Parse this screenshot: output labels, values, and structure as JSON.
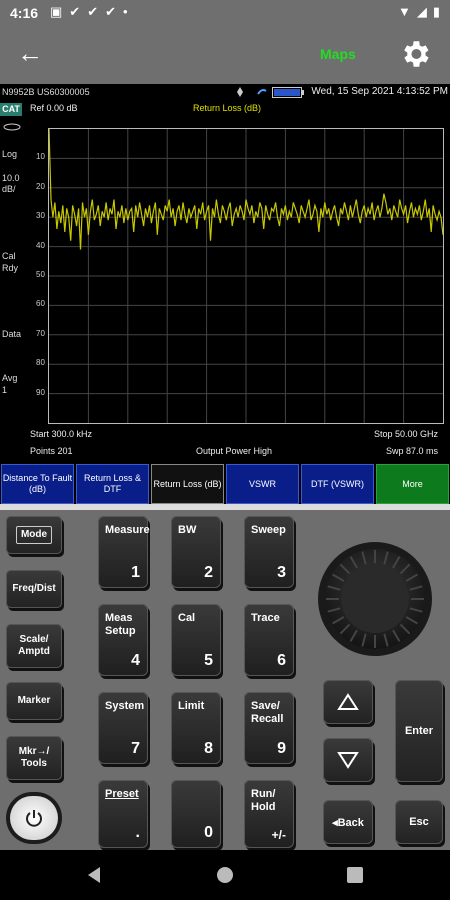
{
  "status_bar": {
    "time": "4:16"
  },
  "app_bar": {
    "maps_label": "Maps"
  },
  "instrument": {
    "model_serial": "N9952B US60300005",
    "datetime": "Wed, 15 Sep 2021 4:13:52 PM",
    "cat_label": "CAT",
    "side_labels": {
      "log": "Log",
      "scale": "10.0",
      "scale_unit": "dB/",
      "cal": "Cal",
      "cal_state": "Rdy",
      "data": "Data",
      "avg": "Avg",
      "avg_val": "1"
    },
    "ref_level": "Ref 0.00 dB",
    "trace_title": "Return Loss (dB)",
    "start": "Start 300.0 kHz",
    "stop": "Stop 50.00 GHz",
    "points": "Points 201",
    "output_power": "Output Power High",
    "sweep": "Swp 87.0 ms",
    "softkeys": [
      {
        "label": "Distance To Fault (dB)"
      },
      {
        "label": "Return Loss & DTF"
      },
      {
        "label": "Return Loss (dB)"
      },
      {
        "label": "VSWR"
      },
      {
        "label": "DTF (VSWR)"
      },
      {
        "label": "More"
      }
    ]
  },
  "chart_data": {
    "type": "line",
    "title": "Return Loss (dB)",
    "xlabel": "",
    "ylabel": "",
    "x_range": [
      "300.0 kHz",
      "50.00 GHz"
    ],
    "ylim": [
      0,
      100
    ],
    "y_ticks": [
      "10",
      "20",
      "30",
      "40",
      "50",
      "60",
      "70",
      "80",
      "90"
    ],
    "series": [
      {
        "color": "#c8c800",
        "values": [
          0,
          24,
          30,
          25,
          34,
          28,
          32,
          26,
          35,
          27,
          30,
          38,
          26,
          29,
          33,
          27,
          41,
          25,
          30,
          27,
          36,
          28,
          24,
          31,
          29,
          26,
          33,
          28,
          30,
          25,
          31,
          27,
          29,
          24,
          34,
          28,
          30,
          26,
          32,
          27,
          31,
          28,
          27,
          35,
          26,
          30,
          25,
          29,
          33,
          27,
          30,
          26,
          32,
          28,
          25,
          36,
          27,
          29,
          31,
          26,
          28,
          24,
          30,
          27,
          33,
          28,
          26,
          31,
          25,
          29,
          32,
          27,
          30,
          28,
          26,
          34,
          27,
          29,
          25,
          31,
          28,
          26,
          38,
          27,
          30,
          24,
          29,
          32,
          26,
          28,
          31,
          27,
          25,
          33,
          29,
          27,
          30,
          26,
          28,
          31,
          24,
          27,
          29,
          26,
          32,
          28,
          30,
          25,
          27,
          34,
          26,
          29,
          31,
          27,
          28,
          25,
          30,
          33,
          27,
          29,
          26,
          31,
          28,
          30,
          25,
          27,
          29,
          32,
          26,
          28,
          30,
          27,
          24,
          31,
          29,
          26,
          28,
          35,
          27,
          30,
          25,
          29,
          27,
          31,
          28,
          26,
          30,
          33,
          27,
          29,
          25,
          28,
          31,
          26,
          30,
          27,
          24,
          29,
          32,
          28,
          26,
          30,
          27,
          29,
          25,
          31,
          28,
          26,
          30,
          27,
          22,
          25,
          29,
          27,
          31,
          26,
          28,
          30,
          24,
          27,
          29,
          26,
          32,
          28,
          25,
          30,
          27,
          29,
          26,
          31,
          28,
          24,
          30,
          27,
          35,
          26,
          29,
          31,
          28,
          30,
          36
        ]
      }
    ],
    "grid": true
  },
  "keypad": {
    "left": [
      "Mode",
      "Freq/Dist",
      "Scale/ Amptd",
      "Marker",
      "Mkr→/ Tools"
    ],
    "keys": [
      {
        "label": "Measure",
        "num": "1"
      },
      {
        "label": "BW",
        "num": "2"
      },
      {
        "label": "Sweep",
        "num": "3"
      },
      {
        "label": "Meas Setup",
        "num": "4"
      },
      {
        "label": "Cal",
        "num": "5"
      },
      {
        "label": "Trace",
        "num": "6"
      },
      {
        "label": "System",
        "num": "7"
      },
      {
        "label": "Limit",
        "num": "8"
      },
      {
        "label": "Save/ Recall",
        "num": "9"
      },
      {
        "label": "Preset",
        "num": "."
      },
      {
        "label": "",
        "num": "0"
      },
      {
        "label": "Run/ Hold",
        "num": "+/-"
      }
    ],
    "enter": "Enter",
    "back": "◂Back",
    "esc": "Esc"
  }
}
